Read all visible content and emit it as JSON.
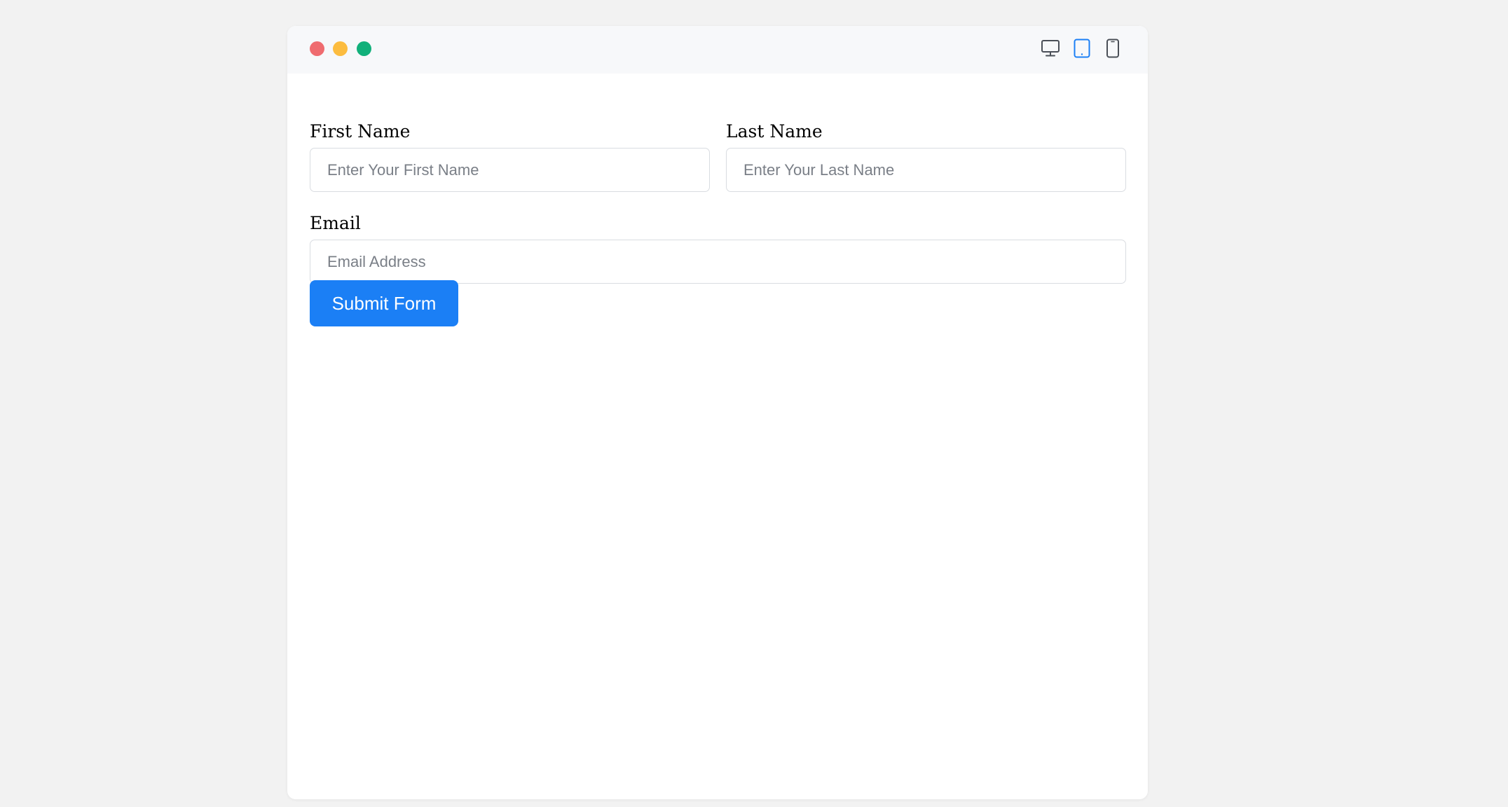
{
  "window": {
    "controls": [
      "close",
      "minimize",
      "maximize"
    ],
    "colors": {
      "close": "#ef6b6f",
      "minimize": "#fcbc3f",
      "maximize": "#11b07a",
      "accent": "#1b7ff5"
    }
  },
  "toolbar": {
    "icons": [
      "desktop-icon",
      "tablet-icon",
      "mobile-icon"
    ],
    "selected": "tablet"
  },
  "form": {
    "first_name": {
      "label": "First Name",
      "placeholder": "Enter Your First Name",
      "value": ""
    },
    "last_name": {
      "label": "Last Name",
      "placeholder": "Enter Your Last Name",
      "value": ""
    },
    "email": {
      "label": "Email",
      "placeholder": "Email Address",
      "value": ""
    },
    "submit_label": "Submit Form"
  }
}
